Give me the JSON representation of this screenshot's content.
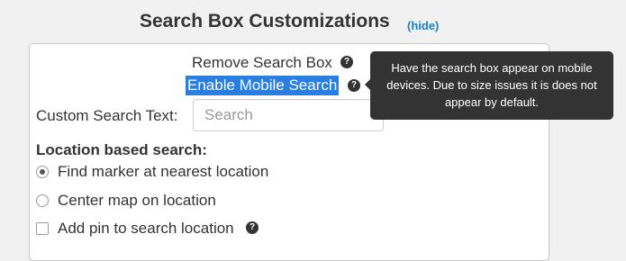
{
  "header": {
    "title": "Search Box Customizations",
    "hide_link": "(hide)"
  },
  "options": {
    "remove_search_box": "Remove Search Box",
    "enable_mobile_search": "Enable Mobile Search",
    "help_glyph": "?",
    "custom_search_text_label": "Custom Search Text:",
    "custom_search_text_placeholder": "Search",
    "custom_search_text_value": ""
  },
  "location_search": {
    "title": "Location based search:",
    "find_marker": "Find marker at nearest location",
    "find_marker_selected": true,
    "center_map": "Center map on location",
    "center_map_selected": false,
    "add_pin": "Add pin to search location",
    "add_pin_checked": false
  },
  "tooltip": {
    "text": "Have the search box appear on mobile devices. Due to size issues it is does not appear by default."
  },
  "colors": {
    "selection": "#2a7de1",
    "link": "#1a82c4",
    "tooltip_bg": "#333333",
    "page_bg": "#f1f1f1"
  }
}
